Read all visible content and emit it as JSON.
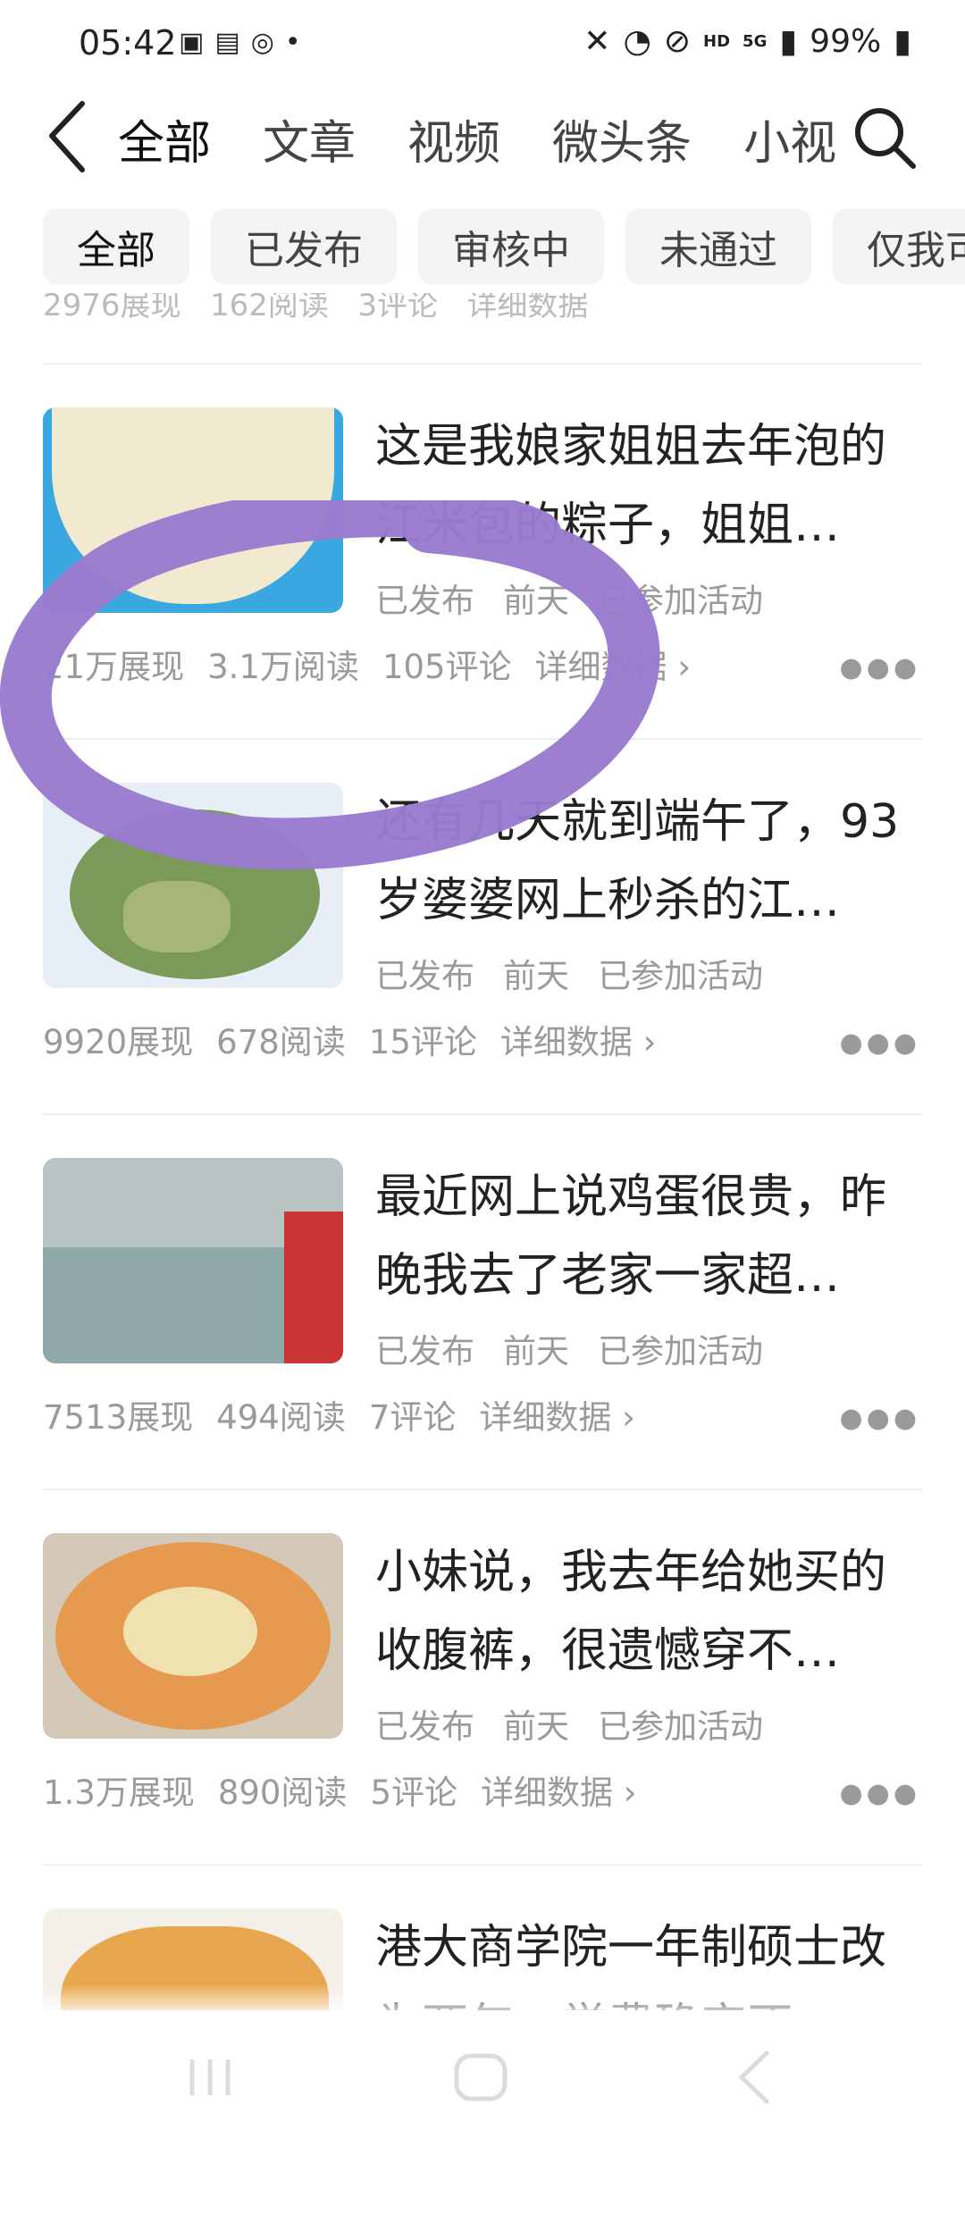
{
  "status_bar": {
    "time": "05:42",
    "network": "HD",
    "signal": "5G",
    "battery": "99%"
  },
  "nav": {
    "tabs": [
      {
        "label": "全部",
        "active": true
      },
      {
        "label": "文章",
        "active": false
      },
      {
        "label": "视频",
        "active": false
      },
      {
        "label": "微头条",
        "active": false
      },
      {
        "label": "小视",
        "active": false
      }
    ]
  },
  "filters": [
    {
      "label": "全部",
      "selected": true
    },
    {
      "label": "已发布",
      "selected": false
    },
    {
      "label": "审核中",
      "selected": false
    },
    {
      "label": "未通过",
      "selected": false
    },
    {
      "label": "仅我可",
      "selected": false
    }
  ],
  "partial_item": {
    "impressions": "2976展现",
    "reads": "162阅读",
    "comments": "3评论",
    "details": "详细数据"
  },
  "items": [
    {
      "title": "这是我娘家姐姐去年泡的江米包的粽子，姐姐…",
      "status": "已发布",
      "time": "前天",
      "activity": "已参加活动",
      "impressions": "21万展现",
      "reads": "3.1万阅读",
      "comments": "105评论",
      "details": "详细数据",
      "thumb": "batter-bowl"
    },
    {
      "title": "还有几天就到端午了，93岁婆婆网上秒杀的江…",
      "status": "已发布",
      "time": "前天",
      "activity": "已参加活动",
      "impressions": "9920展现",
      "reads": "678阅读",
      "comments": "15评论",
      "details": "详细数据",
      "thumb": "zongzi-plate"
    },
    {
      "title": "最近网上说鸡蛋很贵，昨晚我去了老家一家超…",
      "status": "已发布",
      "time": "前天",
      "activity": "已参加活动",
      "impressions": "7513展现",
      "reads": "494阅读",
      "comments": "7评论",
      "details": "详细数据",
      "thumb": "supermarket-freezer"
    },
    {
      "title": "小妹说，我去年给她买的收腹裤，很遗憾穿不…",
      "status": "已发布",
      "time": "前天",
      "activity": "已参加活动",
      "impressions": "1.3万展现",
      "reads": "890阅读",
      "comments": "5评论",
      "details": "详细数据",
      "thumb": "noodle-bowl"
    },
    {
      "title": "港大商学院一年制硕士改为两年，学费确定不…",
      "thumb": "fried-snack"
    }
  ],
  "colors": {
    "annotation": "#9a7bd0",
    "chip_bg": "#f4f4f4",
    "meta_text": "#9a9a9a"
  },
  "icons": [
    "back-arrow-icon",
    "search-icon",
    "more-dots-icon",
    "chevron-right-icon",
    "recents-icon",
    "home-icon",
    "back-nav-icon"
  ]
}
